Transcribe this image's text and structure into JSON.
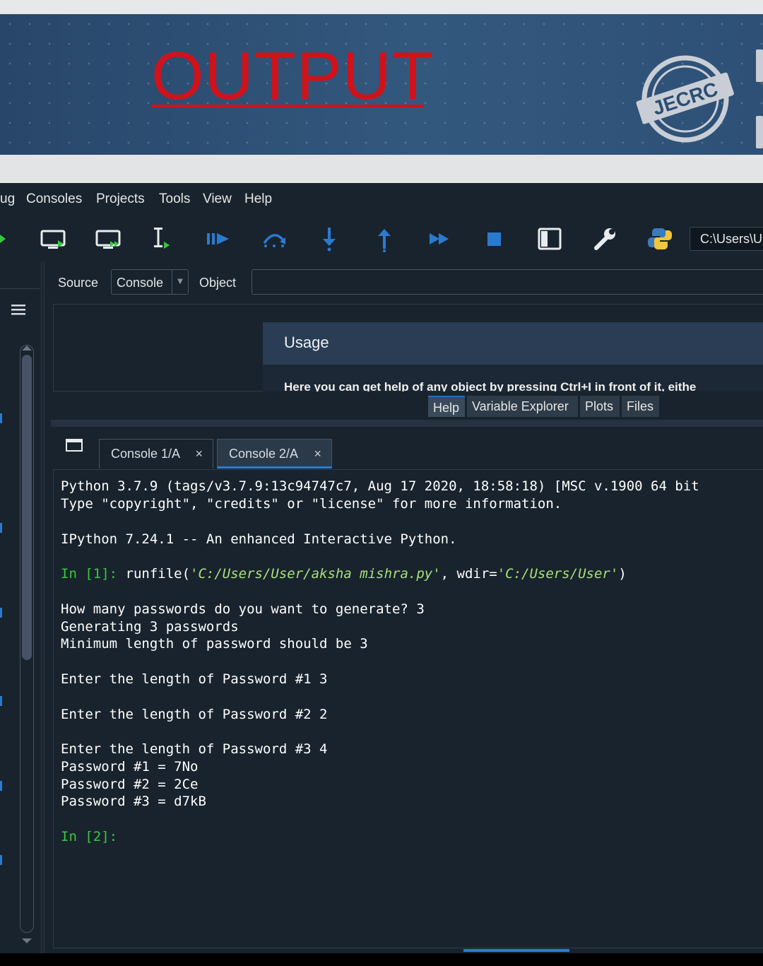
{
  "banner": {
    "title": "OUTPUT",
    "logo": {
      "name": "JECRC",
      "icon": "jecrc-seal-logo"
    },
    "title_color": "#d0121b"
  },
  "menubar": {
    "items": [
      "ug",
      "Consoles",
      "Projects",
      "Tools",
      "View",
      "Help"
    ]
  },
  "toolbar": {
    "icons": [
      "run-cell-icon",
      "run-cell-advance-icon",
      "run-selection-icon",
      "debug-icon",
      "step-over-icon",
      "step-into-icon",
      "step-return-icon",
      "continue-icon",
      "stop-icon",
      "maximize-pane-icon",
      "preferences-wrench-icon",
      "python-path-icon"
    ],
    "working_dir": "C:\\Users\\U"
  },
  "help_pane": {
    "source_label": "Source",
    "source_value": "Console",
    "object_label": "Object",
    "usage_title": "Usage",
    "usage_text": "Here you can get help of any object by pressing Ctrl+I in front of it, eithe",
    "tabs": [
      "Help",
      "Variable Explorer",
      "Plots",
      "Files"
    ],
    "active_tab": "Help"
  },
  "console": {
    "tabs": [
      {
        "label": "Console 1/A",
        "close": "×"
      },
      {
        "label": "Console 2/A",
        "close": "×"
      }
    ],
    "active_tab": "Console 2/A",
    "lines": {
      "l1": "Python 3.7.9 (tags/v3.7.9:13c94747c7, Aug 17 2020, 18:58:18) [MSC v.1900 64 bit",
      "l2": "Type \"copyright\", \"credits\" or \"license\" for more information.",
      "l3": "IPython 7.24.1 -- An enhanced Interactive Python.",
      "prompt1": "In [1]:",
      "cmd_a": " runfile(",
      "cmd_str1": "'C:/Users/User/aksha mishra.py'",
      "cmd_b": ", wdir=",
      "cmd_str2": "'C:/Users/User'",
      "cmd_c": ")",
      "l5": "How many passwords do you want to generate? 3",
      "l6": "Generating 3 passwords",
      "l7": "Minimum length of password should be 3",
      "l8": "Enter the length of Password #1 3",
      "l9": "Enter the length of Password #2 2",
      "l10": "Enter the length of Password #3 4",
      "l11": "Password #1 = 7No",
      "l12": "Password #2 = 2Ce",
      "l13": "Password #3 = d7kB",
      "prompt2": "In [2]:"
    },
    "prompt_color": "#36c940",
    "string_color": "#a8e07c"
  }
}
